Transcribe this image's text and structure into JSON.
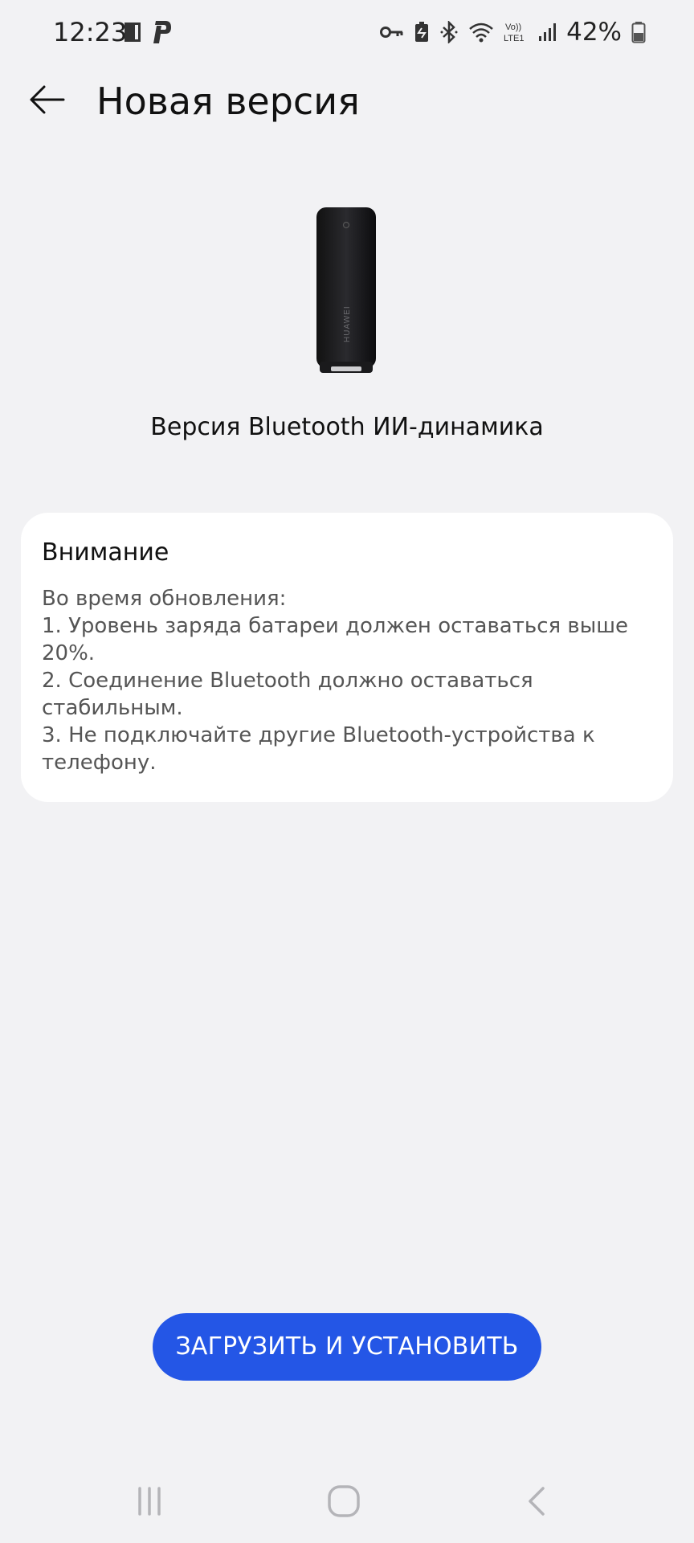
{
  "status_bar": {
    "time": "12:23",
    "battery_text": "42%",
    "icons_left": [
      "sim-card-icon",
      "p-app-icon"
    ],
    "icons_right": [
      "vpn-key-icon",
      "battery-saver-icon",
      "bluetooth-icon",
      "wifi-icon",
      "volte-icon",
      "signal-icon",
      "battery-icon"
    ]
  },
  "header": {
    "title": "Новая версия",
    "back_icon": "arrow-left-icon"
  },
  "device": {
    "name": "Версия Bluetooth ИИ-динамика",
    "image_icon": "speaker-icon",
    "brand": "HUAWEI"
  },
  "notice": {
    "title": "Внимание",
    "lines": [
      "Во время обновления:",
      "1. Уровень заряда батареи должен оставаться выше",
      "20%.",
      "2. Соединение Bluetooth должно оставаться",
      "стабильным.",
      "3. Не подключайте другие Bluetooth-устройства к",
      "телефону."
    ]
  },
  "actions": {
    "download_install_label": "ЗАГРУЗИТЬ И УСТАНОВИТЬ"
  },
  "nav_bar": {
    "recents_icon": "recents-icon",
    "home_icon": "home-icon",
    "back_icon": "back-chevron-icon"
  },
  "colors": {
    "background": "#f2f2f4",
    "card": "#ffffff",
    "accent": "#2456e6",
    "secondary_text": "#555555"
  }
}
